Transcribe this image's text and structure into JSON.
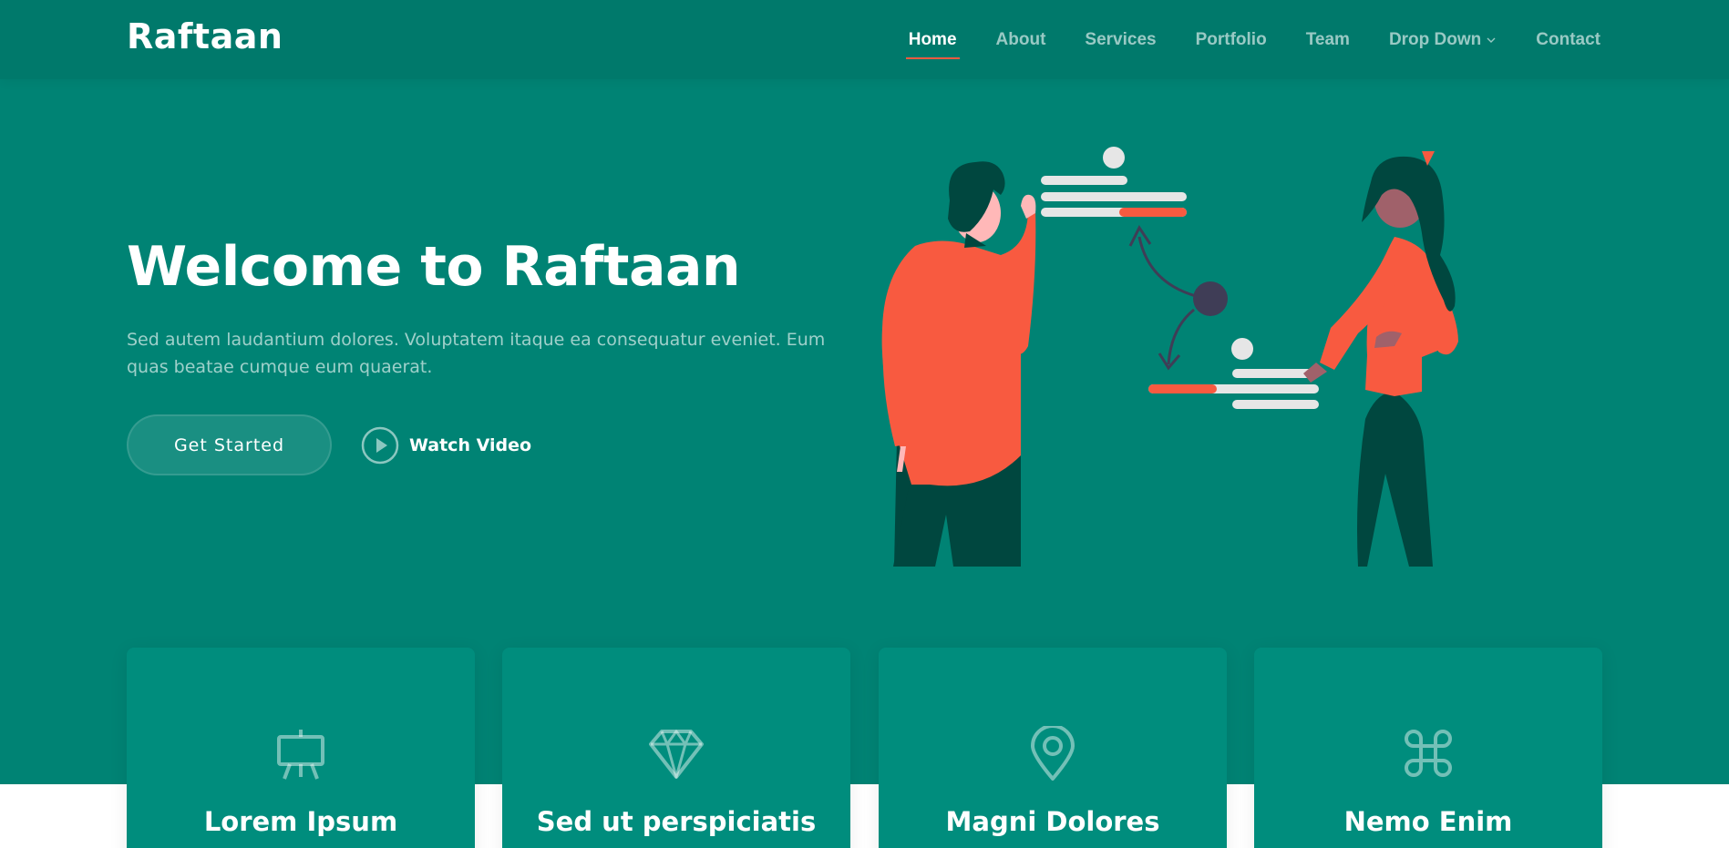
{
  "brand": {
    "name": "Raftaan"
  },
  "nav": {
    "items": [
      {
        "label": "Home",
        "active": true
      },
      {
        "label": "About"
      },
      {
        "label": "Services"
      },
      {
        "label": "Portfolio"
      },
      {
        "label": "Team"
      },
      {
        "label": "Drop Down",
        "dropdown": true
      },
      {
        "label": "Contact"
      }
    ]
  },
  "hero": {
    "title": "Welcome to Raftaan",
    "text": "Sed autem laudantium dolores. Voluptatem itaque ea consequatur eveniet. Eum quas beatae cumque eum quaerat.",
    "primary_button": "Get Started",
    "video_button": "Watch Video"
  },
  "cards": [
    {
      "title": "Lorem Ipsum",
      "icon": "easel-icon"
    },
    {
      "title": "Sed ut perspiciatis",
      "icon": "gem-icon"
    },
    {
      "title": "Magni Dolores",
      "icon": "geo-pin-icon"
    },
    {
      "title": "Nemo Enim",
      "icon": "command-icon"
    }
  ],
  "colors": {
    "primary": "#008374",
    "header": "#00796b",
    "card": "#008d7d",
    "accent": "#f85a40",
    "figure_dark": "#00473f",
    "node": "#3f3d56"
  }
}
